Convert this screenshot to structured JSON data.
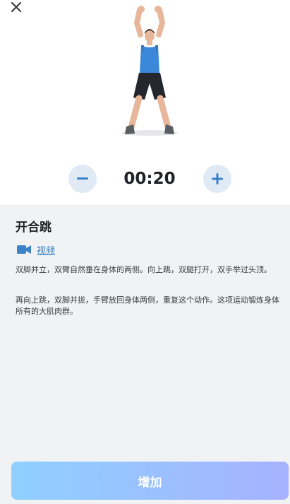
{
  "header": {
    "close_icon": "close-icon"
  },
  "exercise": {
    "name": "开合跳",
    "timer": "00:20",
    "video_label": "视频",
    "description_1": "双脚并立，双臂自然垂在身体的两侧。向上跳，双腿打开，双手举过头顶。",
    "description_2": "再向上跳，双脚并拢，手臂放回身体两侧，重复这个动作。这项运动锻炼身体所有的大肌肉群。"
  },
  "controls": {
    "decrease_icon": "minus-icon",
    "increase_icon": "plus-icon"
  },
  "footer": {
    "add_label": "增加"
  },
  "colors": {
    "accent": "#3b82c6",
    "control_bg": "#dfeaf5",
    "button_gradient_start": "#8fd0ff",
    "button_gradient_end": "#a6b2ff"
  }
}
